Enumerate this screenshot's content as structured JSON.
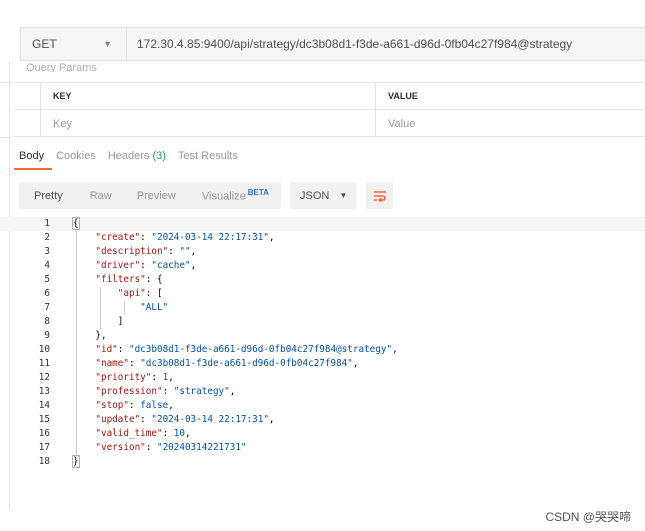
{
  "request": {
    "method": "GET",
    "url": "172.30.4.85:9400/api/strategy/dc3b08d1-f3de-a661-d96d-0fb04c27f984@strategy"
  },
  "params": {
    "title": "Query Params",
    "columns": [
      "KEY",
      "VALUE"
    ],
    "placeholders": {
      "key": "Key",
      "value": "Value"
    }
  },
  "response_tabs": {
    "body": "Body",
    "cookies": "Cookies",
    "headers": "Headers",
    "headers_count": "(3)",
    "test_results": "Test Results"
  },
  "toolbar": {
    "pretty": "Pretty",
    "raw": "Raw",
    "preview": "Preview",
    "visualize": "Visualize",
    "beta": "BETA",
    "format": "JSON"
  },
  "code_lines": [
    "1",
    "2",
    "3",
    "4",
    "5",
    "6",
    "7",
    "8",
    "9",
    "10",
    "11",
    "12",
    "13",
    "14",
    "15",
    "16",
    "17",
    "18"
  ],
  "json": {
    "create_key": "\"create\"",
    "create_val": "\"2024-03-14 22:17:31\"",
    "description_key": "\"description\"",
    "description_val": "\"\"",
    "driver_key": "\"driver\"",
    "driver_val": "\"cache\"",
    "filters_key": "\"filters\"",
    "api_key": "\"api\"",
    "all_val": "\"ALL\"",
    "id_key": "\"id\"",
    "id_val": "\"dc3b08d1-f3de-a661-d96d-0fb04c27f984@strategy\"",
    "name_key": "\"name\"",
    "name_val": "\"dc3b08d1-f3de-a661-d96d-0fb04c27f984\"",
    "priority_key": "\"priority\"",
    "priority_val": "1",
    "profession_key": "\"profession\"",
    "profession_val": "\"strategy\"",
    "stop_key": "\"stop\"",
    "stop_val": "false",
    "update_key": "\"update\"",
    "update_val": "\"2024-03-14 22:17:31\"",
    "valid_time_key": "\"valid_time\"",
    "valid_time_val": "10",
    "version_key": "\"version\"",
    "version_val": "\"20240314221731\""
  },
  "watermark": "CSDN @哭哭啼",
  "colors": {
    "accent": "#f26b3a",
    "key": "#a31515",
    "string": "#0451a5",
    "count": "#21a35a"
  },
  "icons": {
    "method_dropdown": "chevron-down-icon",
    "format_dropdown": "triangle-down-icon",
    "wrap": "wrap-lines-icon"
  }
}
